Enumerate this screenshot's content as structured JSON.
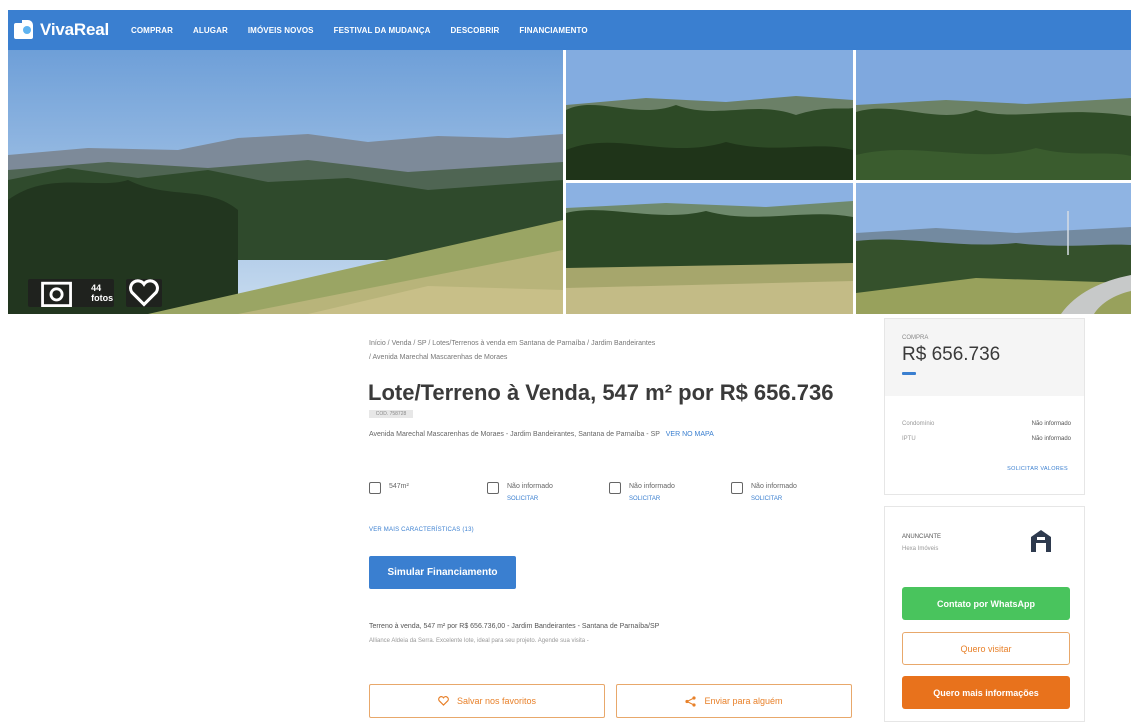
{
  "header": {
    "brand": "VivaReal",
    "nav": [
      "COMPRAR",
      "ALUGAR",
      "IMÓVEIS NOVOS",
      "FESTIVAL DA MUDANÇA",
      "DESCOBRIR",
      "FINANCIAMENTO"
    ]
  },
  "gallery": {
    "photos_count_label": "44 fotos"
  },
  "listing": {
    "breadcrumb_line1": "Início / Venda / SP / Lotes/Terrenos à venda em Santana de Parnaíba / Jardim Bandeirantes",
    "breadcrumb_line2": "/ Avenida Marechal Mascarenhas de Moraes",
    "title": "Lote/Terreno à Venda, 547 m² por R$ 656.736",
    "code": "COD. 758728",
    "address": "Avenida Marechal Mascarenhas de Moraes - Jardim Bandeirantes, Santana de Parnaíba - SP",
    "map_link": "VER NO MAPA",
    "features": [
      {
        "label": "547m²",
        "link": ""
      },
      {
        "label": "Não informado",
        "link": "SOLICITAR"
      },
      {
        "label": "Não informado",
        "link": "SOLICITAR"
      },
      {
        "label": "Não informado",
        "link": "SOLICITAR"
      }
    ],
    "more_features": "VER MAIS CARACTERÍSTICAS (13)",
    "simulate_button": "Simular Financiamento",
    "description_line1": "Terreno à venda, 547 m² por R$ 656.736,00 - Jardim Bandeirantes - Santana de Parnaíba/SP",
    "description_line2": "Alliance Aldeia da Serra. Excelente lote, ideal para seu projeto. Agende sua visita -",
    "save_button": "Salvar nos favoritos",
    "share_button": "Enviar para alguém"
  },
  "price_card": {
    "label": "COMPRA",
    "price": "R$ 656.736",
    "condo_label": "Condomínio",
    "condo_value": "Não informado",
    "iptu_label": "IPTU",
    "iptu_value": "Não informado",
    "request_values": "SOLICITAR VALORES"
  },
  "advertiser": {
    "label": "ANUNCIANTE",
    "name": "Hexa Imóveis",
    "whatsapp_button": "Contato por WhatsApp",
    "visit_button": "Quero visitar",
    "info_button": "Quero mais informações"
  },
  "colors": {
    "brand_blue": "#3a7fd0",
    "whatsapp_green": "#49c45d",
    "orange": "#e8721c"
  }
}
